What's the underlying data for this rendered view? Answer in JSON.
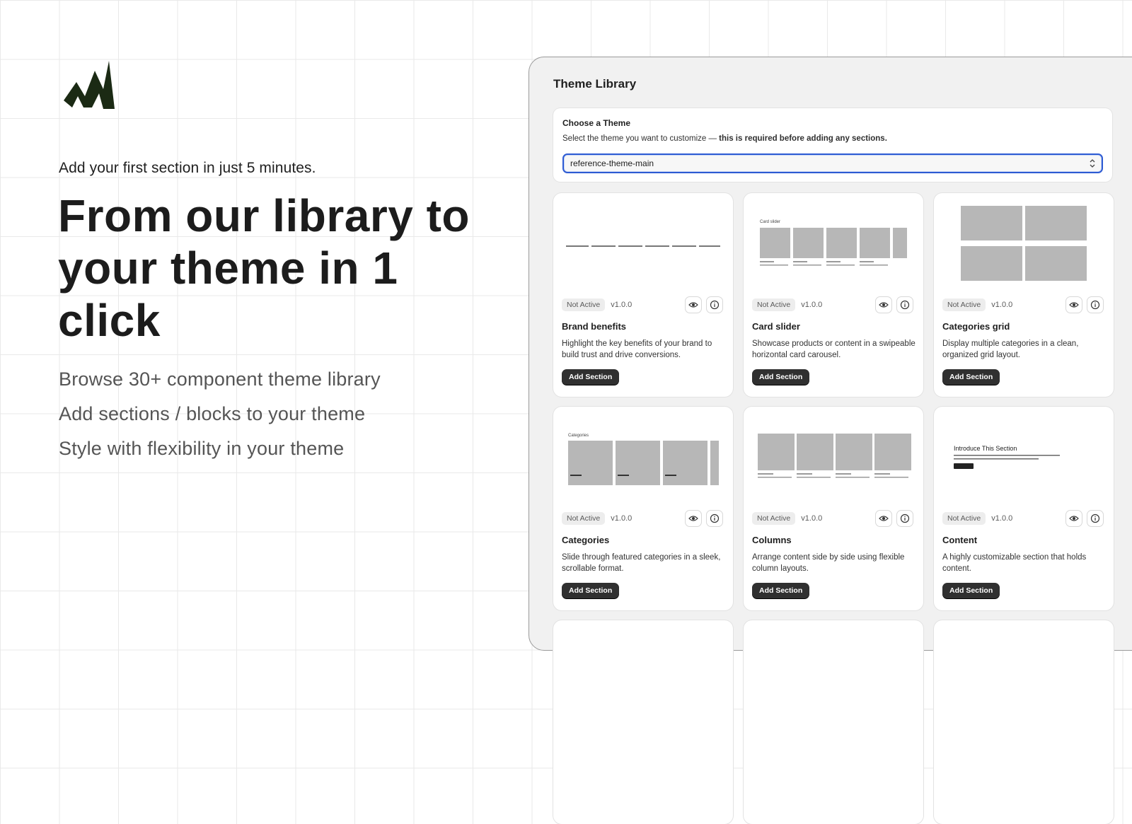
{
  "hero": {
    "kicker": "Add your first section in just 5 minutes.",
    "headline": "From our library to your theme in 1 click",
    "features": [
      "Browse 30+ component theme library",
      "Add sections / blocks to your theme",
      "Style with flexibility in your theme"
    ]
  },
  "app": {
    "title": "Theme Library",
    "theme_picker": {
      "label": "Choose a Theme",
      "description": "Select the theme you want to customize — ",
      "description_bold": "this is required before adding any sections.",
      "selected": "reference-theme-main"
    },
    "cards": [
      {
        "status": "Not Active",
        "version": "v1.0.0",
        "name": "Brand benefits",
        "description": "Highlight the key benefits of your brand to build trust and drive conversions.",
        "button": "Add Section"
      },
      {
        "status": "Not Active",
        "version": "v1.0.0",
        "name": "Card slider",
        "description": "Showcase products or content in a swipeable horizontal card carousel.",
        "button": "Add Section"
      },
      {
        "status": "Not Active",
        "version": "v1.0.0",
        "name": "Categories grid",
        "description": "Display multiple categories in a clean, organized grid layout.",
        "button": "Add Section"
      },
      {
        "status": "Not Active",
        "version": "v1.0.0",
        "name": "Categories",
        "description": "Slide through featured categories in a sleek, scrollable format.",
        "button": "Add Section"
      },
      {
        "status": "Not Active",
        "version": "v1.0.0",
        "name": "Columns",
        "description": "Arrange content side by side using flexible column layouts.",
        "button": "Add Section"
      },
      {
        "status": "Not Active",
        "version": "v1.0.0",
        "name": "Content",
        "description": "A highly customizable section that holds content.",
        "button": "Add Section"
      }
    ],
    "previews": {
      "card_slider_title": "Card slider",
      "categories_title": "Categories",
      "content_title": "Introduce This Section"
    }
  },
  "colors": {
    "accent_focus": "#2d5bd3",
    "button_bg": "#303030",
    "logo": "#1b2a14"
  }
}
